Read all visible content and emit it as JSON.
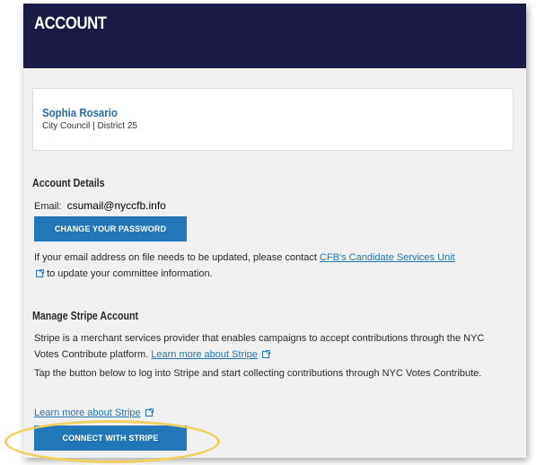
{
  "header": {
    "title": "ACCOUNT"
  },
  "candidate": {
    "name": "Sophia Rosario",
    "office": "City Council | District 25"
  },
  "account_details": {
    "title": "Account Details",
    "email_label": "Email:",
    "email_value": "csumail@nyccfb.info",
    "change_password_label": "CHANGE YOUR PASSWORD",
    "update_text_prefix": "If your email address on file needs to be updated, please contact",
    "update_link": "CFB's Candidate Services Unit",
    "update_text_suffix": "to update your committee information."
  },
  "stripe": {
    "title": "Manage Stripe Account",
    "description": "Stripe is a merchant services provider that enables campaigns to accept contributions through the NYC Votes Contribute platform.",
    "learn_more_inline": "Learn more about Stripe",
    "tap_text": "Tap the button below to log into Stripe and start collecting contributions through NYC Votes Contribute.",
    "learn_more_link": "Learn more about Stripe",
    "connect_label": "CONNECT WITH STRIPE"
  },
  "colors": {
    "header_bg": "#1b1a44",
    "button_bg": "#2277b9",
    "link": "#2277b9",
    "highlight": "#f2cf5e"
  },
  "icons": [
    "external-link-icon"
  ]
}
